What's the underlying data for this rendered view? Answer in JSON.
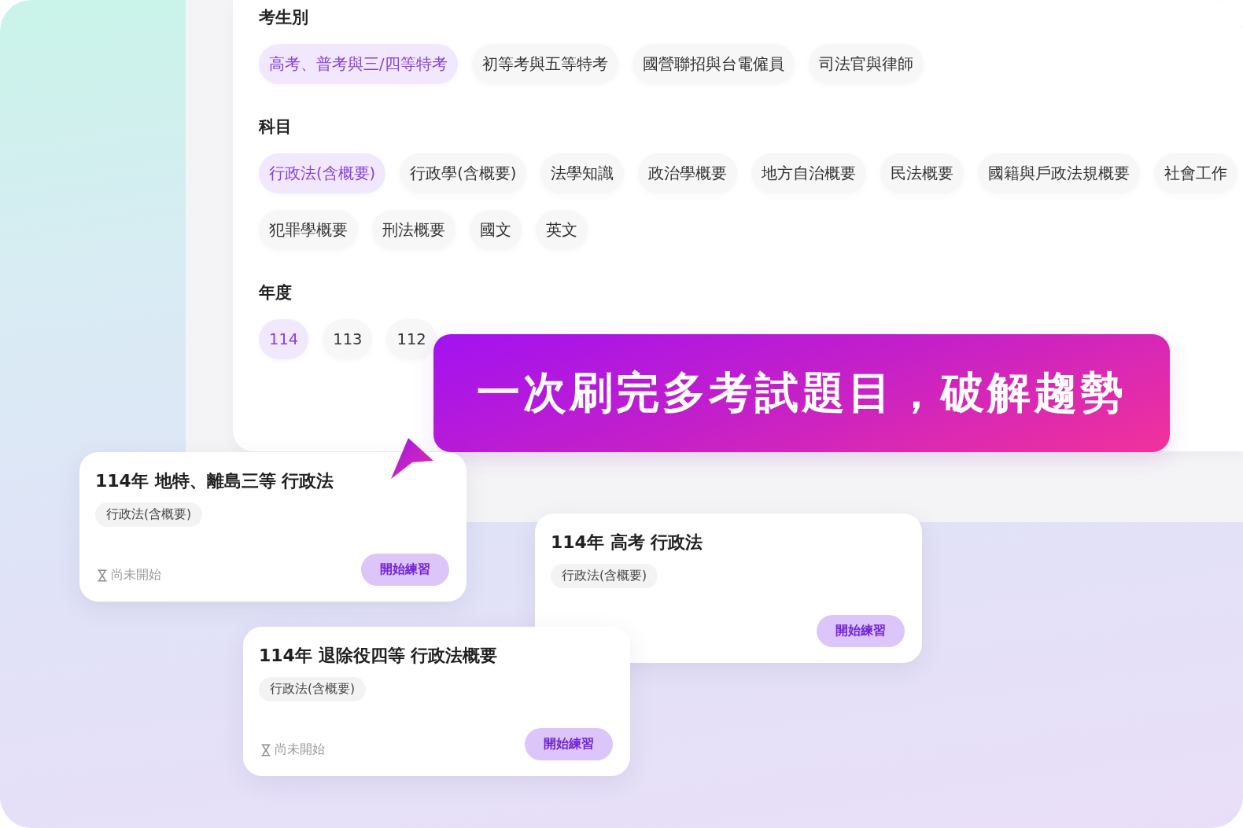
{
  "filters": [
    {
      "heading": "考生別",
      "options": [
        {
          "label": "高考、普考與三/四等特考",
          "selected": true
        },
        {
          "label": "初等考與五等特考",
          "selected": false
        },
        {
          "label": "國營聯招與台電僱員",
          "selected": false
        },
        {
          "label": "司法官與律師",
          "selected": false
        }
      ]
    },
    {
      "heading": "科目",
      "options": [
        {
          "label": "行政法(含概要)",
          "selected": true
        },
        {
          "label": "行政學(含概要)",
          "selected": false
        },
        {
          "label": "法學知識",
          "selected": false
        },
        {
          "label": "政治學概要",
          "selected": false
        },
        {
          "label": "地方自治概要",
          "selected": false
        },
        {
          "label": "民法概要",
          "selected": false
        },
        {
          "label": "國籍與戶政法規概要",
          "selected": false
        },
        {
          "label": "社會工作",
          "selected": false
        },
        {
          "label": "犯罪學概要",
          "selected": false
        },
        {
          "label": "刑法概要",
          "selected": false
        },
        {
          "label": "國文",
          "selected": false
        },
        {
          "label": "英文",
          "selected": false
        }
      ]
    },
    {
      "heading": "年度",
      "options": [
        {
          "label": "114",
          "selected": true
        },
        {
          "label": "113",
          "selected": false
        },
        {
          "label": "112",
          "selected": false
        }
      ]
    }
  ],
  "banner": {
    "text": "一次刷完多考試題目，破解趨勢"
  },
  "cards": [
    {
      "title": "114年 地特、離島三等 行政法",
      "tag": "行政法(含概要)",
      "status": "尚未開始",
      "button": "開始練習"
    },
    {
      "title": "114年 高考 行政法",
      "tag": "行政法(含概要)",
      "button": "開始練習"
    },
    {
      "title": "114年 退除役四等 行政法概要",
      "tag": "行政法(含概要)",
      "status": "尚未開始",
      "button": "開始練習"
    }
  ]
}
